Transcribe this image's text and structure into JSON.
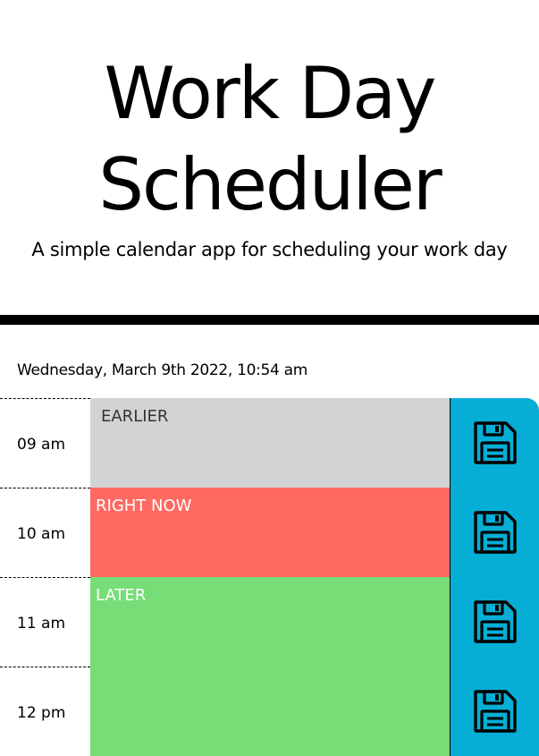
{
  "header": {
    "title_line1": "Work Day",
    "title_line2": "Scheduler",
    "subtitle": "A simple calendar app for scheduling your work day"
  },
  "current_day": "Wednesday, March 9th 2022, 10:54 am",
  "colors": {
    "past": "#d3d3d3",
    "present": "#ff6961",
    "future": "#77dd77",
    "save_button": "#06aed5"
  },
  "time_blocks": [
    {
      "hour": "09 am",
      "status": "past",
      "text": "EARLIER",
      "save_icon": "save-icon"
    },
    {
      "hour": "10 am",
      "status": "present",
      "text": "RIGHT NOW",
      "save_icon": "save-icon"
    },
    {
      "hour": "11 am",
      "status": "future",
      "text": "LATER",
      "save_icon": "save-icon"
    },
    {
      "hour": "12 pm",
      "status": "future",
      "text": "",
      "save_icon": "save-icon"
    }
  ]
}
